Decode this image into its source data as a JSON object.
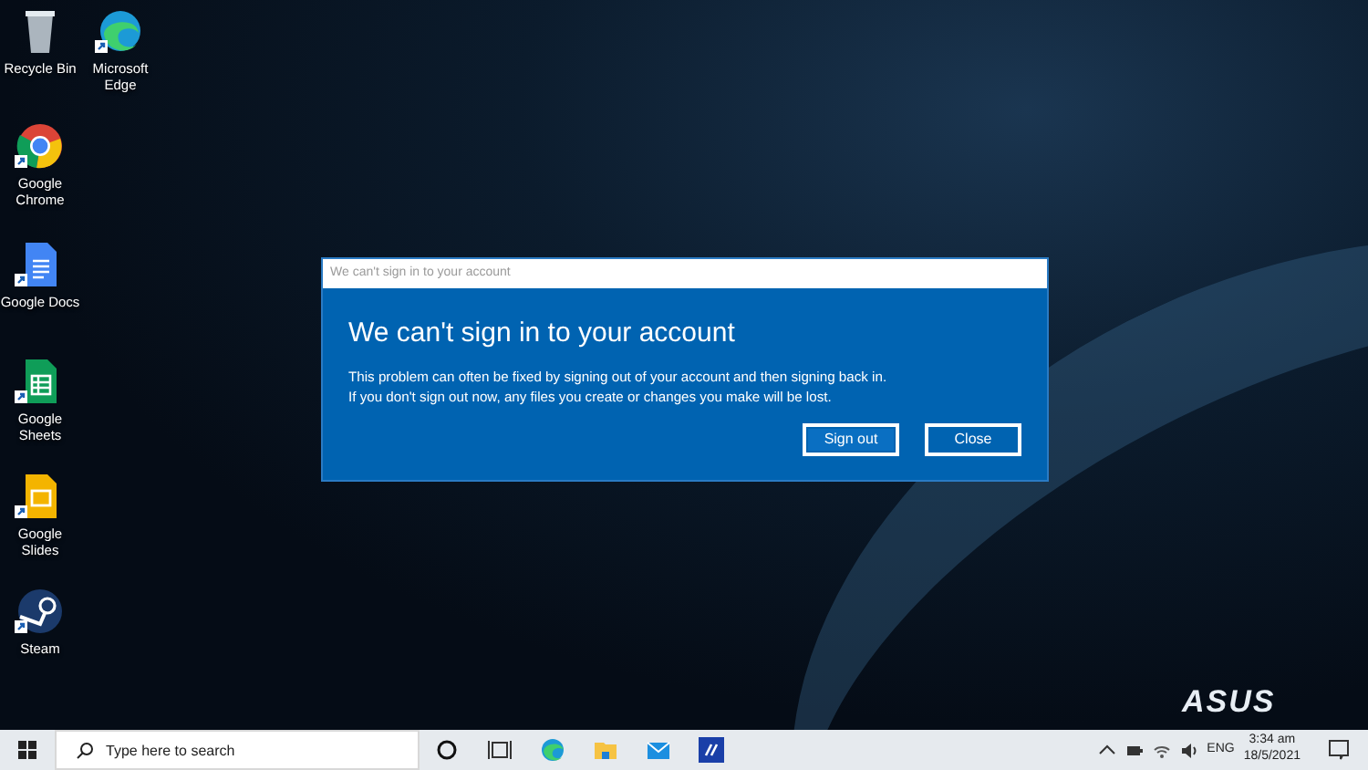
{
  "desktop_icons": [
    {
      "label": "Recycle Bin",
      "kind": "recycle-bin",
      "shortcut": false
    },
    {
      "label": "Microsoft Edge",
      "kind": "edge",
      "shortcut": true
    },
    {
      "label": "Google Chrome",
      "kind": "chrome",
      "shortcut": true
    },
    {
      "label": "Google Docs",
      "kind": "docs",
      "shortcut": true
    },
    {
      "label": "Google Sheets",
      "kind": "sheets",
      "shortcut": true
    },
    {
      "label": "Google Slides",
      "kind": "slides",
      "shortcut": true
    },
    {
      "label": "Steam",
      "kind": "steam",
      "shortcut": true
    }
  ],
  "wallpaper_logo": "ASUS",
  "dialog": {
    "window_title": "We can't sign in to your account",
    "heading": "We can't sign in to your account",
    "message_lines": [
      "This problem can often be fixed by signing out of your account and then signing back in.",
      "If you don't sign out now, any files you create or changes you make will be lost."
    ],
    "buttons": [
      {
        "label": "Sign out",
        "selected": true
      },
      {
        "label": "Close",
        "selected": false
      }
    ]
  },
  "taskbar": {
    "search": {
      "placeholder": "Type here to search"
    },
    "pinned": [
      {
        "kind": "cortana"
      },
      {
        "kind": "task-view"
      },
      {
        "kind": "edge"
      },
      {
        "kind": "folder"
      },
      {
        "kind": "mail"
      },
      {
        "kind": "app"
      }
    ],
    "tray": {
      "language": "ENG",
      "time": "3:34 am",
      "date": "18/5/2021"
    }
  }
}
